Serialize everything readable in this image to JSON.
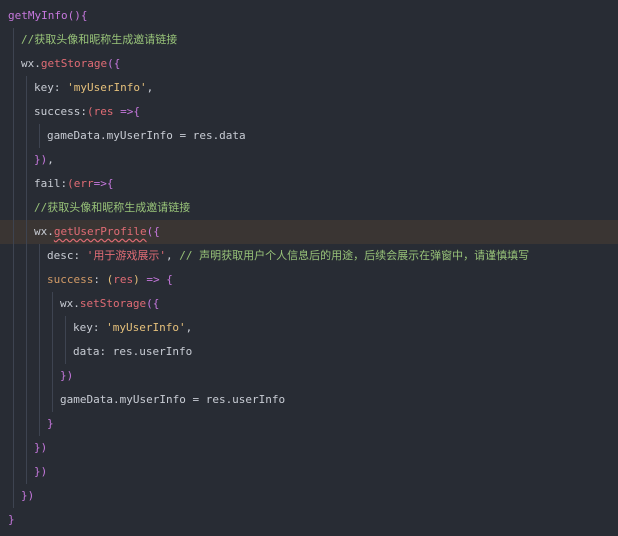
{
  "lines": [
    {
      "indent": 0,
      "tokens": [
        [
          "tok-fn",
          "getMyInfo"
        ],
        [
          "tok-brace",
          "(){"
        ]
      ]
    },
    {
      "indent": 1,
      "tokens": [
        [
          "tok-cmt",
          "//获取头像和昵称生成邀请链接"
        ]
      ]
    },
    {
      "indent": 1,
      "tokens": [
        [
          "tok-plain",
          "wx"
        ],
        [
          "tok-plain",
          "."
        ],
        [
          "tok-method",
          "getStorage"
        ],
        [
          "tok-brace",
          "({"
        ]
      ]
    },
    {
      "indent": 2,
      "tokens": [
        [
          "tok-plain",
          "key"
        ],
        [
          "tok-plain",
          ": "
        ],
        [
          "tok-str",
          "'myUserInfo'"
        ],
        [
          "tok-plain",
          ","
        ]
      ]
    },
    {
      "indent": 2,
      "tokens": [
        [
          "tok-plain",
          "success"
        ],
        [
          "tok-plain",
          ":"
        ],
        [
          "tok-param",
          "(res"
        ],
        [
          "tok-plain",
          " "
        ],
        [
          "tok-arrow",
          "=>"
        ],
        [
          "tok-brace",
          "{"
        ]
      ]
    },
    {
      "indent": 3,
      "tokens": [
        [
          "tok-plain",
          "gameData.myUserInfo = res.data"
        ]
      ]
    },
    {
      "indent": 2,
      "tokens": [
        [
          "tok-brace",
          "})"
        ],
        [
          "tok-plain",
          ","
        ]
      ]
    },
    {
      "indent": 2,
      "tokens": [
        [
          "tok-plain",
          "fail"
        ],
        [
          "tok-plain",
          ":"
        ],
        [
          "tok-param",
          "(err"
        ],
        [
          "tok-arrow",
          "=>"
        ],
        [
          "tok-brace",
          "{"
        ]
      ]
    },
    {
      "indent": 2,
      "tokens": [
        [
          "tok-cmt",
          "//获取头像和昵称生成邀请链接"
        ]
      ]
    },
    {
      "indent": 2,
      "highlight": true,
      "tokens": [
        [
          "tok-plain",
          "wx"
        ],
        [
          "tok-plain",
          "."
        ],
        [
          "tok-method squiggle",
          "getUserProfile"
        ],
        [
          "tok-brace",
          "({"
        ]
      ]
    },
    {
      "indent": 3,
      "tokens": [
        [
          "tok-plain",
          "desc"
        ],
        [
          "tok-plain",
          ": "
        ],
        [
          "tok-str-cn",
          "'用于游戏展示'"
        ],
        [
          "tok-plain",
          ", "
        ],
        [
          "tok-cmt",
          "// 声明获取用户个人信息后的用途，后续会展示在弹窗中，请谨慎填写"
        ]
      ]
    },
    {
      "indent": 3,
      "tokens": [
        [
          "tok-key",
          "success"
        ],
        [
          "tok-plain",
          ": "
        ],
        [
          "tok-paren",
          "("
        ],
        [
          "tok-param",
          "res"
        ],
        [
          "tok-paren",
          ")"
        ],
        [
          "tok-plain",
          " "
        ],
        [
          "tok-arrow",
          "=>"
        ],
        [
          "tok-plain",
          " "
        ],
        [
          "tok-brace",
          "{"
        ]
      ]
    },
    {
      "indent": 4,
      "tokens": [
        [
          "tok-plain",
          "wx"
        ],
        [
          "tok-plain",
          "."
        ],
        [
          "tok-method",
          "setStorage"
        ],
        [
          "tok-brace",
          "({"
        ]
      ]
    },
    {
      "indent": 5,
      "tokens": [
        [
          "tok-plain",
          "key"
        ],
        [
          "tok-plain",
          ": "
        ],
        [
          "tok-str",
          "'myUserInfo'"
        ],
        [
          "tok-plain",
          ","
        ]
      ]
    },
    {
      "indent": 5,
      "tokens": [
        [
          "tok-plain",
          "data"
        ],
        [
          "tok-plain",
          ": res.userInfo"
        ]
      ]
    },
    {
      "indent": 4,
      "tokens": [
        [
          "tok-brace",
          "})"
        ]
      ]
    },
    {
      "indent": 4,
      "tokens": [
        [
          "tok-plain",
          "gameData.myUserInfo = res.userInfo"
        ]
      ]
    },
    {
      "indent": 3,
      "tokens": [
        [
          "tok-brace",
          "}"
        ]
      ]
    },
    {
      "indent": 2,
      "tokens": [
        [
          "tok-brace",
          "})"
        ]
      ]
    },
    {
      "indent": 2,
      "tokens": [
        [
          "tok-brace",
          "})"
        ]
      ]
    },
    {
      "indent": 1,
      "tokens": [
        [
          "tok-brace",
          "})"
        ]
      ]
    },
    {
      "indent": 0,
      "tokens": [
        [
          "tok-brace",
          "}"
        ]
      ]
    }
  ]
}
